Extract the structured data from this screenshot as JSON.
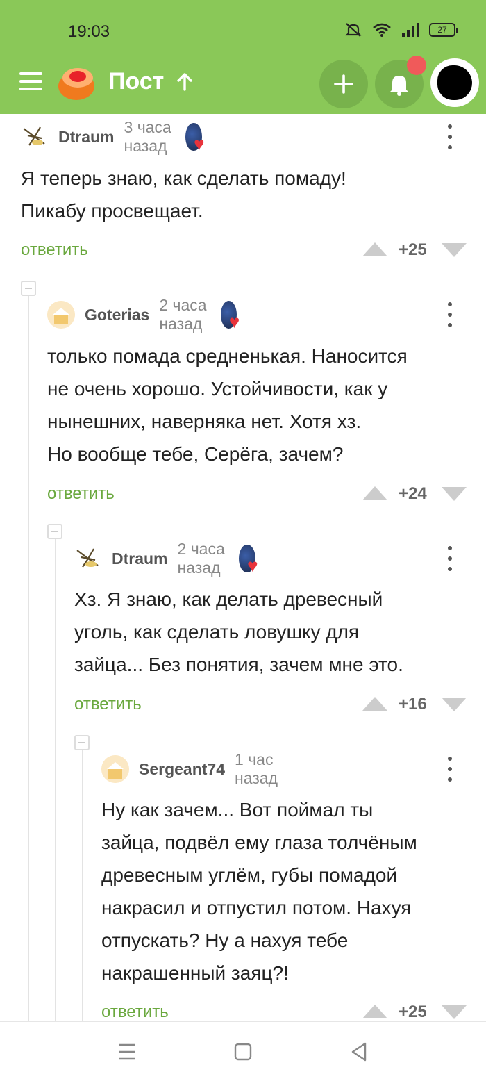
{
  "status_bar": {
    "time": "19:03",
    "battery": "27"
  },
  "header": {
    "title": "Пост"
  },
  "comments": [
    {
      "author": "Dtraum",
      "time": "3 часа назад",
      "text": "Я теперь знаю, как сделать помаду!\nПикабу просвещает.",
      "reply": "ответить",
      "score": "+25"
    },
    {
      "author": "Goterias",
      "time": "2 часа назад",
      "text": "только помада средненькая. Наносится\nне очень хорошо. Устойчивости, как у\nнынешних, наверняка нет. Хотя хз.\nНо вообще тебе, Серёга, зачем?",
      "reply": "ответить",
      "score": "+24"
    },
    {
      "author": "Dtraum",
      "time": "2 часа назад",
      "text": "Хз. Я знаю, как делать древесный\nуголь, как сделать ловушку для\nзайца... Без понятия, зачем мне это.",
      "reply": "ответить",
      "score": "+16"
    },
    {
      "author": "Sergeant74",
      "time": "1 час назад",
      "text": "Ну как зачем... Вот поймал ты\nзайца, подвёл ему глаза толчёным\nдревесным углём, губы помадой\nнакрасил и отпустил потом. Нахуя\nотпускать? Ну а нахуя тебе\nнакрашенный заяц?!",
      "reply": "ответить",
      "score": "+25"
    }
  ],
  "colors": {
    "header_bg": "#8ac858",
    "accent_green": "#6aa83e",
    "notification": "#f05a5a"
  }
}
